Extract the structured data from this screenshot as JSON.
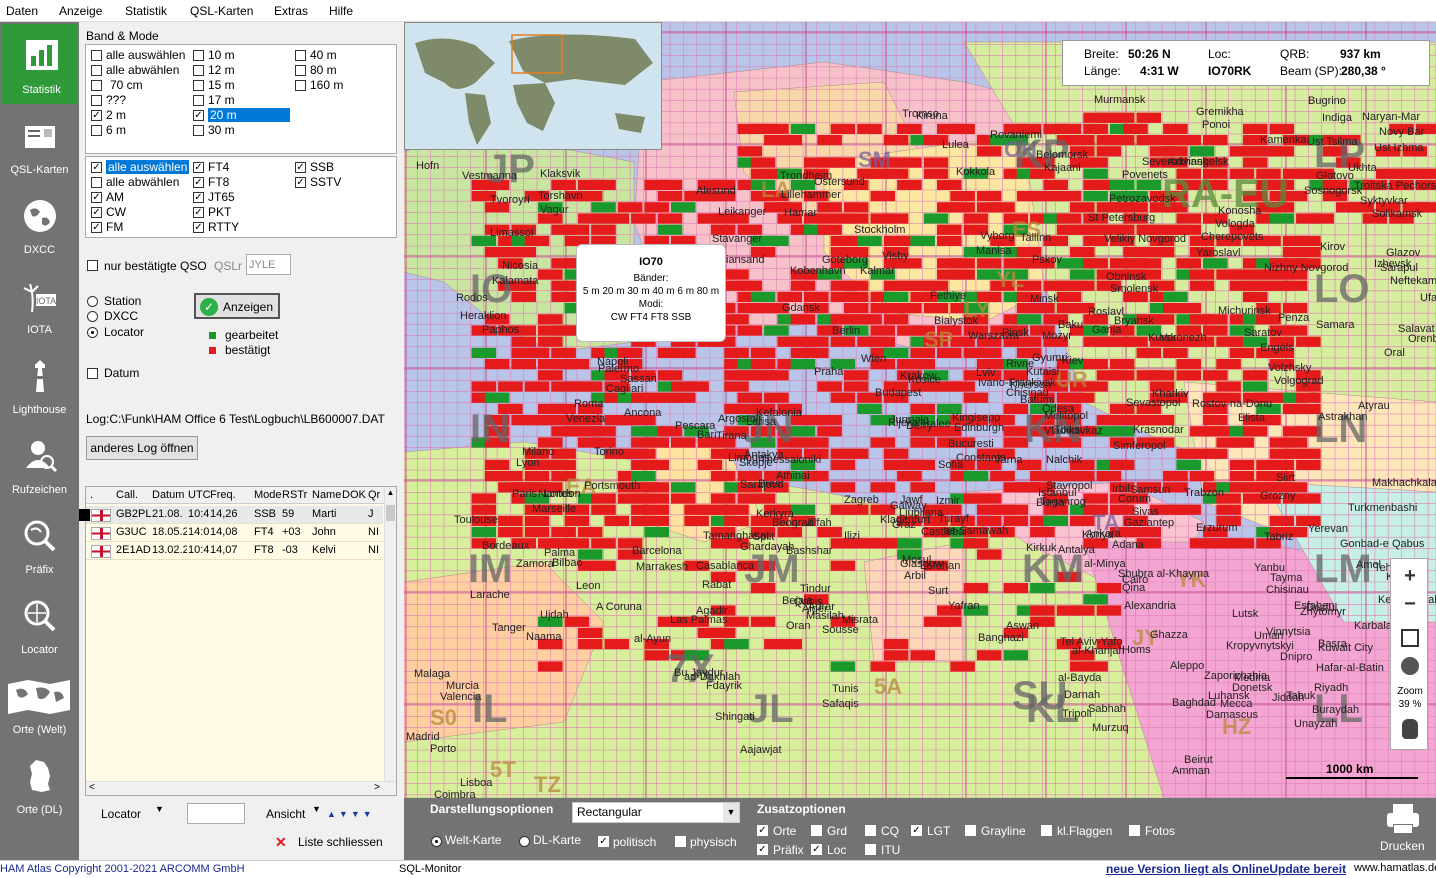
{
  "menu": [
    "Daten",
    "Anzeige",
    "Statistik",
    "QSL-Karten",
    "Extras",
    "Hilfe"
  ],
  "sidebar": [
    {
      "label": "Statistik",
      "icon": "chart-icon"
    },
    {
      "label": "QSL-Karten",
      "icon": "qsl-card-icon"
    },
    {
      "label": "DXCC",
      "icon": "globe-icon"
    },
    {
      "label": "IOTA",
      "icon": "iota-island-icon"
    },
    {
      "label": "Lighthouse",
      "icon": "lighthouse-icon"
    },
    {
      "label": "Rufzeichen",
      "icon": "callsign-search-icon"
    },
    {
      "label": "Präfix",
      "icon": "prefix-search-icon"
    },
    {
      "label": "Locator",
      "icon": "locator-search-icon"
    },
    {
      "label": "Orte (Welt)",
      "icon": "world-map-icon"
    },
    {
      "label": "Orte (DL)",
      "icon": "germany-map-icon"
    }
  ],
  "band_mode": {
    "title": "Band & Mode",
    "bands": [
      {
        "label": "alle auswählen",
        "checked": false
      },
      {
        "label": "10 m",
        "checked": false
      },
      {
        "label": "40 m",
        "checked": false
      },
      {
        "label": "alle abwählen",
        "checked": false
      },
      {
        "label": "12 m",
        "checked": false
      },
      {
        "label": "80 m",
        "checked": false
      },
      {
        "label": "70 cm",
        "checked": false
      },
      {
        "label": "15 m",
        "checked": false
      },
      {
        "label": "160 m",
        "checked": false
      },
      {
        "label": "???",
        "checked": false
      },
      {
        "label": "17 m",
        "checked": false
      },
      {
        "label": "2 m",
        "checked": true
      },
      {
        "label": "20 m",
        "checked": true
      },
      {
        "label": "6 m",
        "checked": false
      },
      {
        "label": "30 m",
        "checked": false
      }
    ],
    "modes": [
      {
        "label": "alle auswählen",
        "checked": true
      },
      {
        "label": "FT4",
        "checked": true
      },
      {
        "label": "SSB",
        "checked": true
      },
      {
        "label": "alle abwählen",
        "checked": false
      },
      {
        "label": "FT8",
        "checked": true
      },
      {
        "label": "SSTV",
        "checked": true
      },
      {
        "label": "AM",
        "checked": true
      },
      {
        "label": "JT65",
        "checked": true
      },
      {
        "label": "CW",
        "checked": true
      },
      {
        "label": "PKT",
        "checked": true
      },
      {
        "label": "FM",
        "checked": true
      },
      {
        "label": "RTTY",
        "checked": true
      }
    ]
  },
  "filter": {
    "confirmed_only": "nur bestätigte QSO",
    "qsl_label": "QSLr",
    "qsl_value": "JYLE",
    "radios": [
      "Station",
      "DXCC",
      "Locator"
    ],
    "selected_radio": "Locator",
    "show_button": "Anzeigen",
    "legend_worked": "gearbeitet",
    "legend_confirmed": "bestätigt",
    "color_worked": "#1a9a2a",
    "color_confirmed": "#e51a1a",
    "date_label": "Datum"
  },
  "log": {
    "path": "Log:C:\\Funk\\HAM Office 6 Test\\Logbuch\\LB600007.DAT",
    "open_button": "anderes Log öffnen",
    "columns": [
      ".",
      "Call.",
      "Datum",
      "UTC",
      "Freq.",
      "Mode",
      "RSTr",
      "Name",
      "DOK",
      "Qr"
    ],
    "rows": [
      [
        " ",
        "GB2PL",
        "21.08.",
        "10:4",
        "14,26",
        "SSB",
        "59",
        "Marti",
        "",
        "J"
      ],
      [
        " ",
        "G3UC",
        "18.05.2",
        "14:0",
        "14,08",
        "FT4",
        "+03",
        "John",
        "",
        "NI"
      ],
      [
        " ",
        "2E1AD",
        "13.02.2",
        "10:4",
        "14,07",
        "FT8",
        "-03",
        "Kelvi",
        "",
        "NI"
      ]
    ],
    "locator_label": "Locator",
    "view_label": "Ansicht",
    "close_list": "Liste schliessen"
  },
  "map_info": {
    "lat_label": "Breite:",
    "lat": "50:26 N",
    "lon_label": "Länge:",
    "lon": "4:31 W",
    "loc_label": "Loc:",
    "loc": "IO70RK",
    "qrb_label": "QRB:",
    "qrb": "937 km",
    "beam_label": "Beam (SP):",
    "beam": "280,38 °"
  },
  "tooltip": {
    "title": "IO70",
    "bands_label": "Bänder:",
    "bands": "5 m  20 m  30 m  40 m  6 m  80 m",
    "modes_label": "Modi:",
    "modes": "CW  FT4  FT8  SSB"
  },
  "map_labels": {
    "prefixes": [
      "JP",
      "SM",
      "OH",
      "LA",
      "IO",
      "IN",
      "IM",
      "IL",
      "JN",
      "JM",
      "JL",
      "KN",
      "KM",
      "KL",
      "KP",
      "LP",
      "LO",
      "LN",
      "LM",
      "LL",
      "RA-EU",
      "7X",
      "TA",
      "SU",
      "HZ",
      "EA",
      "5A",
      "TZ",
      "5T",
      "S0",
      "JY",
      "YK",
      "UR",
      "SP",
      "YL",
      "LY",
      "ES"
    ],
    "cities": [
      "Tromso",
      "Kiruna",
      "Murmansk",
      "Hofn",
      "Vestmanna",
      "Klaksvik",
      "Tvoroyri",
      "Torshavn",
      "Vagur",
      "Bugrino",
      "Naryan-Mar",
      "Indiga",
      "Novy Bar",
      "Ust Izhma",
      "Kamenka",
      "Ust Tsilma",
      "Ukhta",
      "Glotovo",
      "Sosnogorsk",
      "Troitska Pechorsk",
      "Syktyvkar",
      "Solikamsk",
      "Gremikha",
      "Ponoi",
      "Lulea",
      "Rovaniemi",
      "Kokkola",
      "Belomorsk",
      "Severodvinsk",
      "Arkhangelsk",
      "Povenets",
      "Trondheim",
      "Ostersund",
      "Lillehammer",
      "Hamar",
      "Alesund",
      "Leikanger",
      "Stavanger",
      "Kristiansand",
      "Stockholm",
      "Visby",
      "Kalmar",
      "Goteborg",
      "Kobenhavn",
      "Gdansk",
      "Pskov",
      "Tallinn",
      "St Petersburg",
      "Petrozavodsk",
      "Kajaani",
      "Vyborg",
      "Velikiy Novgorod",
      "Konosha",
      "Vologda",
      "Cherepovets",
      "Yaroslavl",
      "Kirov",
      "Glazov",
      "Izhevsk",
      "Sarapul",
      "Neftekamsk",
      "Ufa",
      "Nizhny Novgorod",
      "Obninsk",
      "Smolensk",
      "Minsk",
      "Roslavl",
      "Bryansk",
      "Michurinsk",
      "Penza",
      "Samara",
      "Salavat",
      "Orenburg",
      "Oral",
      "Saratov",
      "Engels",
      "Volzhsky",
      "Volgograd",
      "Astrakhan",
      "Atyrau",
      "Elista",
      "Rostov-na-Donu",
      "Krasnodar",
      "Simferopol",
      "Sevastopol",
      "Melitopol",
      "Odesa",
      "Chisinau",
      "Kherson",
      "Kharkiv",
      "Kursk",
      "Voronezh",
      "Kiev",
      "Rivne",
      "Lviv",
      "Ivano-Frankivsk",
      "Bialystok",
      "Warszawa",
      "Pinsk",
      "Mozyr",
      "Berlin",
      "Praha",
      "Wien",
      "Budapest",
      "Krakow",
      "Kosice",
      "Bucuresti",
      "Constanta",
      "Varna",
      "Sofia",
      "Istanbul",
      "Ankara",
      "Konya",
      "Adana",
      "Antalya",
      "Bursa",
      "Izmir",
      "Samsun",
      "Corum",
      "Sivas",
      "Gaziantep",
      "Trabzon",
      "Erzurum",
      "Siirt",
      "Tabriz",
      "Yerevan",
      "Grozny",
      "Makhachkala",
      "Turkmenbashi",
      "Gonbad-e Qabus",
      "Amol",
      "Tehran",
      "Karaj",
      "Qazvin",
      "Kermanshah",
      "Esfahan",
      "Dezful",
      "Karbala",
      "Basra",
      "Kuwait City",
      "Hafar-al-Batin",
      "Riyadh",
      "Buraydah",
      "Unayzah",
      "Medina",
      "Mecca",
      "Jiddah",
      "Tabuk",
      "Baghdad",
      "Damascus",
      "Beirut",
      "Amman",
      "Aleppo",
      "Homs",
      "Ghazza",
      "Tel Aviv-Yafo",
      "Alexandria",
      "Cairo",
      "Shubra al-Khayma",
      "al-Minya",
      "Qina",
      "Aswan",
      "al-Kharijah",
      "Banghazi",
      "al-Bayda",
      "Darnah",
      "Sabhah",
      "Murzuq",
      "Tripoli",
      "Misrata",
      "Surt",
      "Yafran",
      "Tunis",
      "Safaqis",
      "Qabis",
      "Sousse",
      "Bejaia",
      "Alger",
      "Oran",
      "Masilah",
      "Jilfah",
      "Ghardayah",
      "Bashshar",
      "Adrar",
      "Tindur",
      "Ilizi",
      "Tamanghasat",
      "Marrakesh",
      "Rabat",
      "Casablanca",
      "Agadir",
      "Las Palmas",
      "al-Ayun",
      "Bu Jaydur",
      "ad-Dakhlah",
      "Fdayrik",
      "Shingati",
      "Aajawjat",
      "Naama",
      "Ujdah",
      "Larache",
      "Tanger",
      "Malaga",
      "Murcia",
      "Valencia",
      "Madrid",
      "Porto",
      "Lisboa",
      "Coimbra",
      "A Coruna",
      "Leon",
      "Zamora",
      "Bilbao",
      "Barcelona",
      "Palma",
      "Marseille",
      "Toulouse",
      "Bordeaux",
      "Nantes",
      "Lyon",
      "Paris",
      "London",
      "Portsmouth",
      "Brest",
      "Limoges",
      "Torino",
      "Milano",
      "Venezia",
      "Roma",
      "Napoli",
      "Palermo",
      "Cagliari",
      "Sassari",
      "Ancona",
      "Pescara",
      "Bari",
      "Tirana",
      "Skopje",
      "Thessaloniki",
      "Athinai",
      "Kerkyra",
      "Split",
      "Sarajevo",
      "Beograd",
      "Zagreb",
      "Ljubljana",
      "Graz",
      "Klagenfurt",
      "Glasgow",
      "Castlebar",
      "Galway",
      "Tralee",
      "Derry",
      "Edinburgh",
      "Kingisepp",
      "Jurmala",
      "Rijeka",
      "Larisa",
      "Argostoli",
      "Kefalonia",
      "Kalamata",
      "Rodos",
      "Heraklion",
      "Paphos",
      "Limassol",
      "Nicosia",
      "Manisa",
      "Fethiye",
      "Antakya",
      "Irbil",
      "Kirkuk",
      "Mosul",
      "Arbil",
      "Esfahan",
      "Turayf",
      "as-Samawah",
      "Jawf",
      "Tayma",
      "Yanbu",
      "Chisinau",
      "Lutsk",
      "Zhytomyr",
      "Vinnytsia",
      "Uman",
      "Kropyvnytskyi",
      "Dnipro",
      "Zaporizhzhia",
      "Donetsk",
      "Luhansk",
      "Taganrog",
      "Stavropol",
      "Nalchik",
      "Vladikavkaz",
      "Tbilisi",
      "Batumi",
      "Kutaisi",
      "Gyumri",
      "Baku",
      "Ganja"
    ],
    "scale": "1000 km",
    "zoom_label": "Zoom",
    "zoom_value": "39 %"
  },
  "bottom": {
    "display_title": "Darstellungsoptionen",
    "projection": "Rectangular",
    "world_map": "Welt-Karte",
    "dl_map": "DL-Karte",
    "political": "politisch",
    "physical": "physisch",
    "extra_title": "Zusatzoptionen",
    "options": [
      {
        "label": "Orte",
        "checked": true
      },
      {
        "label": "Grd",
        "checked": false
      },
      {
        "label": "CQ",
        "checked": false
      },
      {
        "label": "LGT",
        "checked": true
      },
      {
        "label": "Grayline",
        "checked": false
      },
      {
        "label": "kl.Flaggen",
        "checked": false
      },
      {
        "label": "Fotos",
        "checked": false
      },
      {
        "label": "Präfix",
        "checked": true
      },
      {
        "label": "Loc",
        "checked": true
      },
      {
        "label": "ITU",
        "checked": false
      }
    ],
    "print": "Drucken"
  },
  "statusbar": {
    "copyright": "HAM Atlas Copyright 2001-2021 ARCOMM GmbH",
    "monitor": "SQL-Monitor",
    "update": "neue Version liegt als OnlineUpdate bereit",
    "website": "www.hamatlas.de"
  }
}
